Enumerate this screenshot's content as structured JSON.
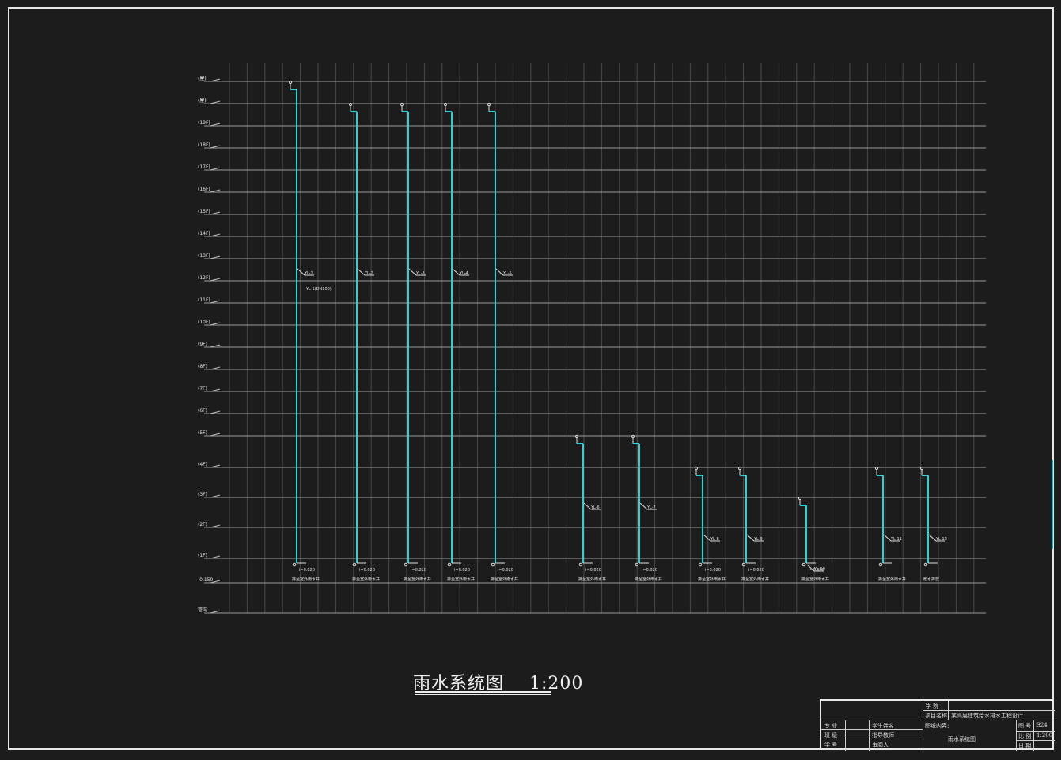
{
  "drawing": {
    "title": "雨水系统图    1:200",
    "colors": {
      "background": "#1c1c1c",
      "grid": "#4a4a4a",
      "pipe": "#2ad4d4",
      "text": "#e8e8e8"
    },
    "floor_labels": [
      "(屋)",
      "(屋)",
      "(19F)",
      "(18F)",
      "(17F)",
      "(16F)",
      "(15F)",
      "(14F)",
      "(13F)",
      "(12F)",
      "(11F)",
      "(10F)",
      "(9F)",
      "(8F)",
      "(7F)",
      "(6F)",
      "(5F)",
      "(4F)",
      "(3F)",
      "(2F)",
      "(1F)",
      "-0.150",
      "管沟"
    ],
    "risers": [
      {
        "id": "YL-1",
        "note": "YL-1(DN100)",
        "sub": "i=0.020",
        "desc": "排至室外雨水井"
      },
      {
        "id": "YL-2",
        "sub": "i=0.020",
        "desc": "排至室外雨水井"
      },
      {
        "id": "YL-3",
        "sub": "i=0.020",
        "desc": "排至室外雨水井"
      },
      {
        "id": "YL-4",
        "sub": "i=0.020",
        "desc": "排至室外雨水井"
      },
      {
        "id": "YL-5",
        "sub": "i=0.020",
        "desc": "排至室外雨水井"
      },
      {
        "id": "YL-6",
        "sub": "i=0.020",
        "desc": "排至室外雨水井"
      },
      {
        "id": "YL-7",
        "sub": "i=0.020",
        "desc": "排至室外雨水井"
      },
      {
        "id": "YL-8",
        "sub": "i=0.020",
        "desc": "排至室外雨水井"
      },
      {
        "id": "YL-9",
        "sub": "i=0.020",
        "desc": "排至室外雨水井"
      },
      {
        "id": "YL-10",
        "sub": "i=0.020",
        "desc": "排至室外雨水井"
      },
      {
        "id": "YL-11",
        "desc": "排至室外雨水井"
      },
      {
        "id": "YL-12",
        "desc": "散水排放"
      }
    ]
  },
  "title_block": {
    "school": "学  院",
    "project_label": "项目名称",
    "project": "某高层建筑给水排水工程设计",
    "major": "专  业",
    "student": "学生姓名",
    "content_label": "图纸内容:",
    "drawing_no_label": "图  号",
    "drawing_no": "S24",
    "class": "班  级",
    "advisor": "指导教师",
    "scale_label": "比  例",
    "scale": "1:200",
    "student_no": "学  号",
    "reviewer": "审阅人",
    "content": "雨水系统图",
    "date_label": "日  期"
  }
}
